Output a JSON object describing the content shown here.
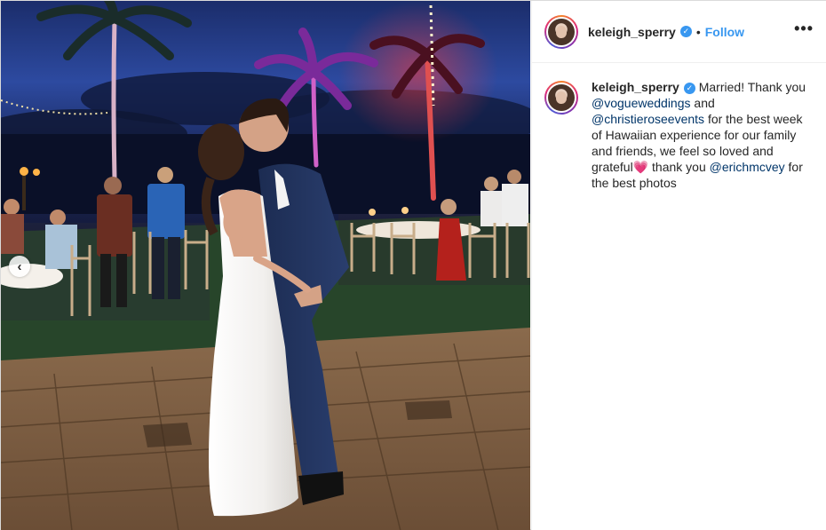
{
  "post": {
    "author": {
      "username": "keleigh_sperry",
      "verified": true,
      "verified_icon": "verified-badge-icon",
      "avatar_icon": "profile-avatar"
    },
    "header": {
      "separator": "•",
      "follow_label": "Follow",
      "more_icon": "more-options-icon",
      "more_label": "•••"
    },
    "caption": {
      "text_1": "Married! Thank you",
      "mention_1": "@vogueweddings",
      "text_2": "and",
      "mention_2": "@christieroseevents",
      "text_3": "for the best week of Hawaiian experience for our family and friends, we feel so loved and grateful",
      "emoji": "💗",
      "text_4": "thank you",
      "mention_3": "@erichmcvey",
      "text_5": "for the best photos"
    },
    "media": {
      "type": "photo",
      "prev_icon": "chevron-left-icon",
      "prev_label": "‹"
    }
  },
  "colors": {
    "link": "#003569",
    "follow": "#3897f0",
    "text": "#262626",
    "border": "#dbdbdb"
  }
}
